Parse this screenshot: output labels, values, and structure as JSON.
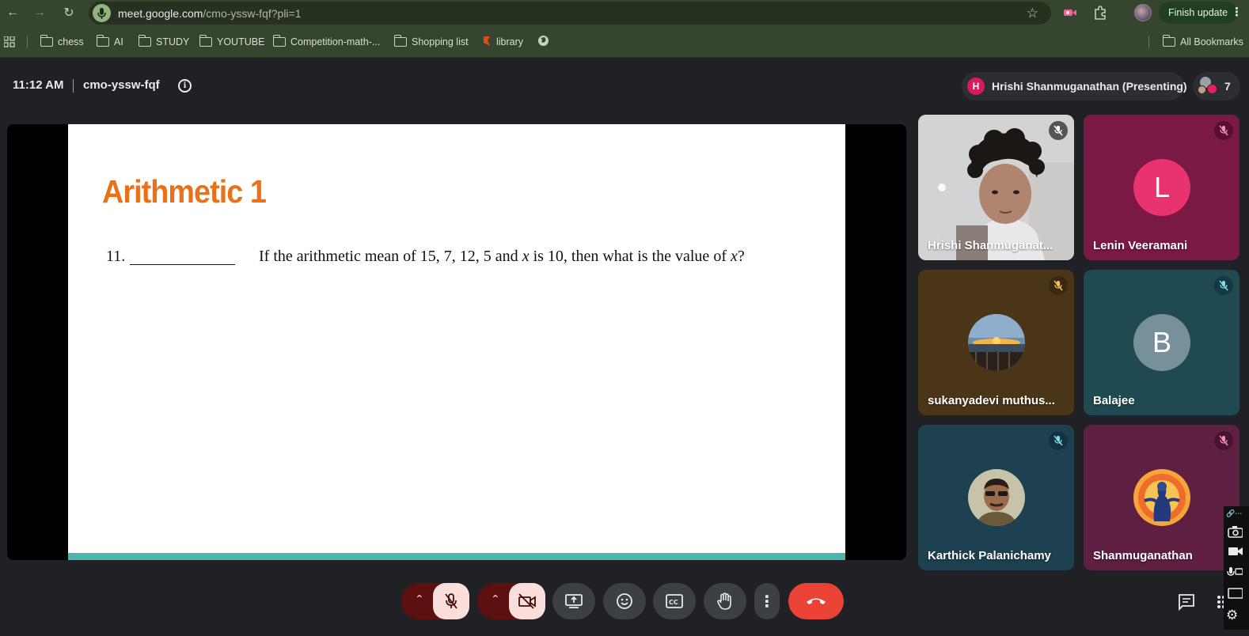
{
  "browser": {
    "url_host": "meet.google.com",
    "url_path": "/cmo-yssw-fqf?pli=1",
    "finish_update": "Finish update",
    "bookmarks": [
      "chess",
      "AI",
      "STUDY",
      "YOUTUBE",
      "Competition-math-...",
      "Shopping list",
      "library"
    ],
    "all_bookmarks": "All Bookmarks"
  },
  "meeting": {
    "time": "11:12 AM",
    "code": "cmo-yssw-fqf",
    "presenter_initial": "H",
    "presenter_label": "Hrishi Shanmuganathan (Presenting)",
    "participant_count": "7"
  },
  "slide": {
    "title": "Arithmetic 1",
    "number": "11.",
    "question_pre": "If the arithmetic mean of 15, 7, 12, 5 and ",
    "question_var1": "x",
    "question_mid": " is 10, then what is the value of ",
    "question_var2": "x",
    "question_post": "?"
  },
  "participants": [
    {
      "name": "Hrishi Shanmuganat...",
      "type": "video",
      "muted": true
    },
    {
      "name": "Lenin Veeramani",
      "initial": "L",
      "type": "letter",
      "avatar_color": "#e8336f",
      "tile_color": "#7a1a44",
      "muted": true
    },
    {
      "name": "sukanyadevi muthus...",
      "type": "photo",
      "tile_color": "#4a3516",
      "muted": true
    },
    {
      "name": "Balajee",
      "initial": "B",
      "type": "letter",
      "avatar_color": "#78909c",
      "tile_color": "#1f4a52",
      "muted": true
    },
    {
      "name": "Karthick Palanichamy",
      "type": "photo",
      "tile_color": "#1d4150",
      "muted": true
    },
    {
      "name": "Shanmuganathan",
      "type": "photo",
      "tile_color": "#5e1f40",
      "muted": true
    }
  ],
  "controls": {
    "mic_state": "muted",
    "camera_state": "off",
    "icons": [
      "present-icon",
      "emoji-icon",
      "captions-icon",
      "raise-hand-icon",
      "more-options-icon",
      "end-call-icon",
      "chat-icon"
    ]
  },
  "colors": {
    "accent_orange": "#e8711a",
    "slide_bar": "#4db6ac",
    "end_call": "#ea4335",
    "muted_red": "#f9dedc"
  }
}
